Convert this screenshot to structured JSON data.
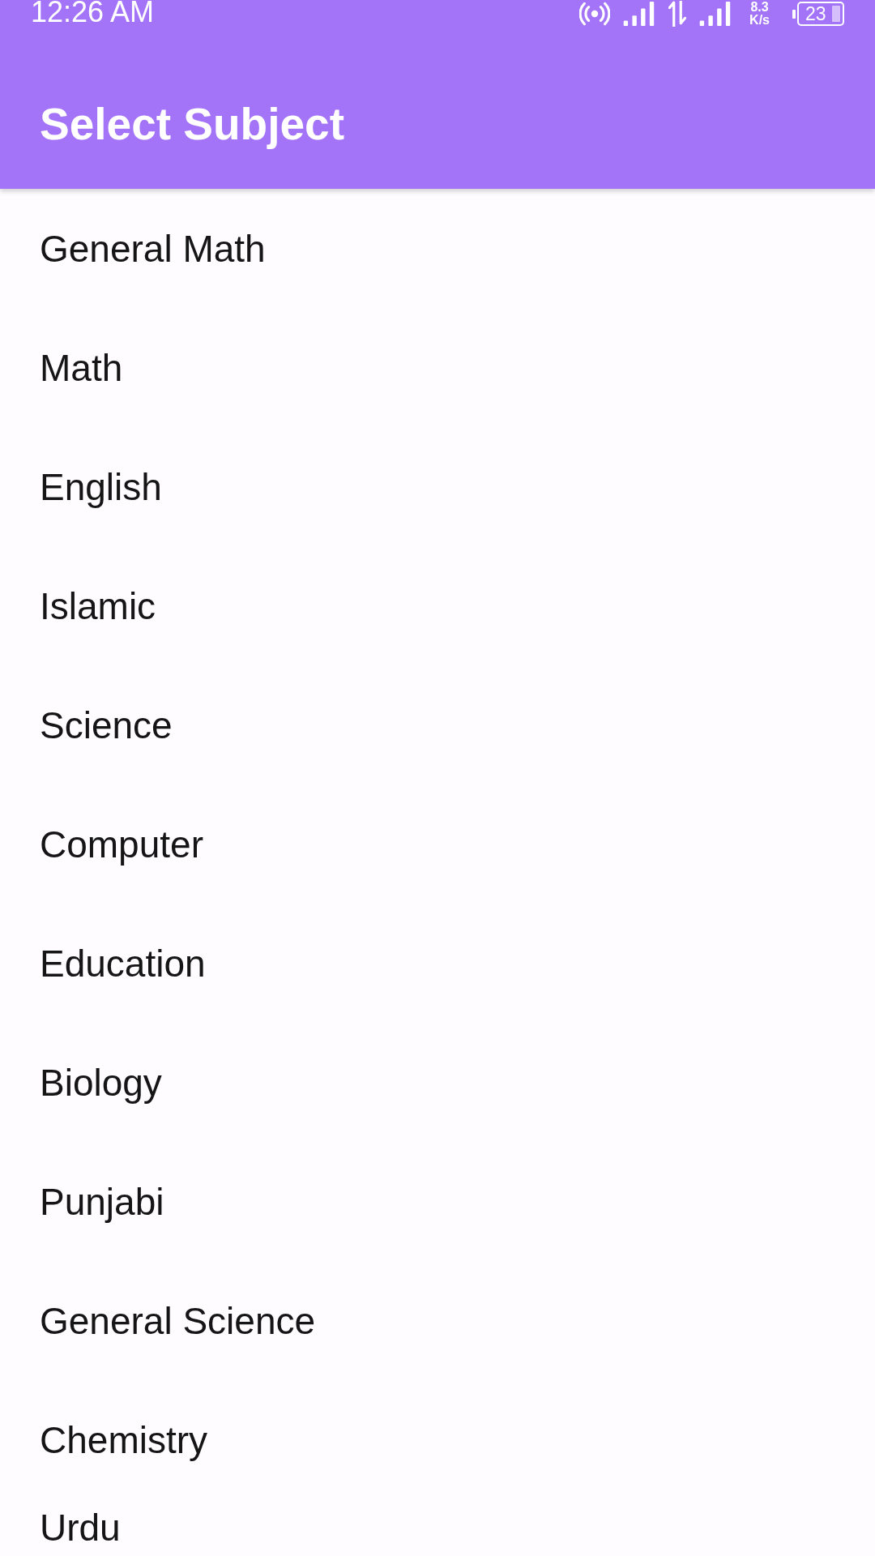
{
  "status_bar": {
    "time": "12:26 AM",
    "speed_value": "8.3",
    "speed_unit": "K/s",
    "battery": "23"
  },
  "app_bar": {
    "title": "Select Subject"
  },
  "subjects": [
    "General Math",
    "Math",
    "English",
    "Islamic",
    "Science",
    "Computer",
    "Education",
    "Biology",
    "Punjabi",
    "General Science",
    "Chemistry",
    "Urdu"
  ]
}
